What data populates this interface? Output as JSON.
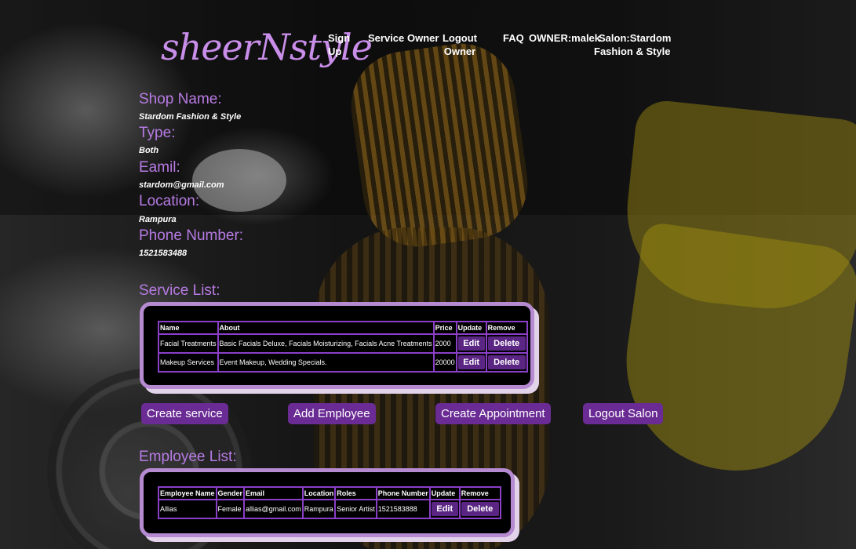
{
  "brand": {
    "logo_text": "sheerNstyle"
  },
  "nav": {
    "signup": "Sign Up",
    "service": "Service",
    "owner": "Owner",
    "logout_owner": "Logout Owner",
    "faq": "FAQ",
    "owner_name": "OWNER:malek",
    "salon_name": "Salon:Stardom Fashion & Style"
  },
  "shop": {
    "name_label": "Shop Name:",
    "name_value": "Stardom Fashion & Style",
    "type_label": "Type:",
    "type_value": "Both",
    "email_label": "Eamil:",
    "email_value": "stardom@gmail.com",
    "location_label": "Location:",
    "location_value": "Rampura",
    "phone_label": "Phone Number:",
    "phone_value": "1521583488"
  },
  "service_list": {
    "title": "Service List:",
    "headers": [
      "Name",
      "About",
      "Price",
      "Update",
      "Remove"
    ],
    "rows": [
      {
        "name": "Facial Treatments",
        "about": "Basic Facials Deluxe, Facials Moisturizing, Facials Acne Treatments",
        "price": "2000",
        "update": "Edit",
        "remove": "Delete"
      },
      {
        "name": "Makeup Services",
        "about": "Event Makeup, Wedding Specials.",
        "price": "20000",
        "update": "Edit",
        "remove": "Delete"
      }
    ]
  },
  "actions": {
    "create_service": "Create service",
    "add_employee": "Add Employee",
    "create_appointment": "Create Appointment",
    "logout_salon": "Logout Salon"
  },
  "employee_list": {
    "title": "Employee List:",
    "headers": [
      "Employee Name",
      "Gender",
      "Email",
      "Location",
      "Roles",
      "Phone Number",
      "Update",
      "Remove"
    ],
    "rows": [
      {
        "name": "Allias",
        "gender": "Female",
        "email": "allias@gmail.com",
        "location": "Rampura",
        "role": "Senior Artist",
        "phone": "1521583888",
        "update": "Edit",
        "remove": "Delete"
      }
    ]
  },
  "colors": {
    "accent": "#b77be4",
    "button": "#6a2b94",
    "table_border": "#8a3fc7",
    "panel_border": "#b58ad0"
  }
}
